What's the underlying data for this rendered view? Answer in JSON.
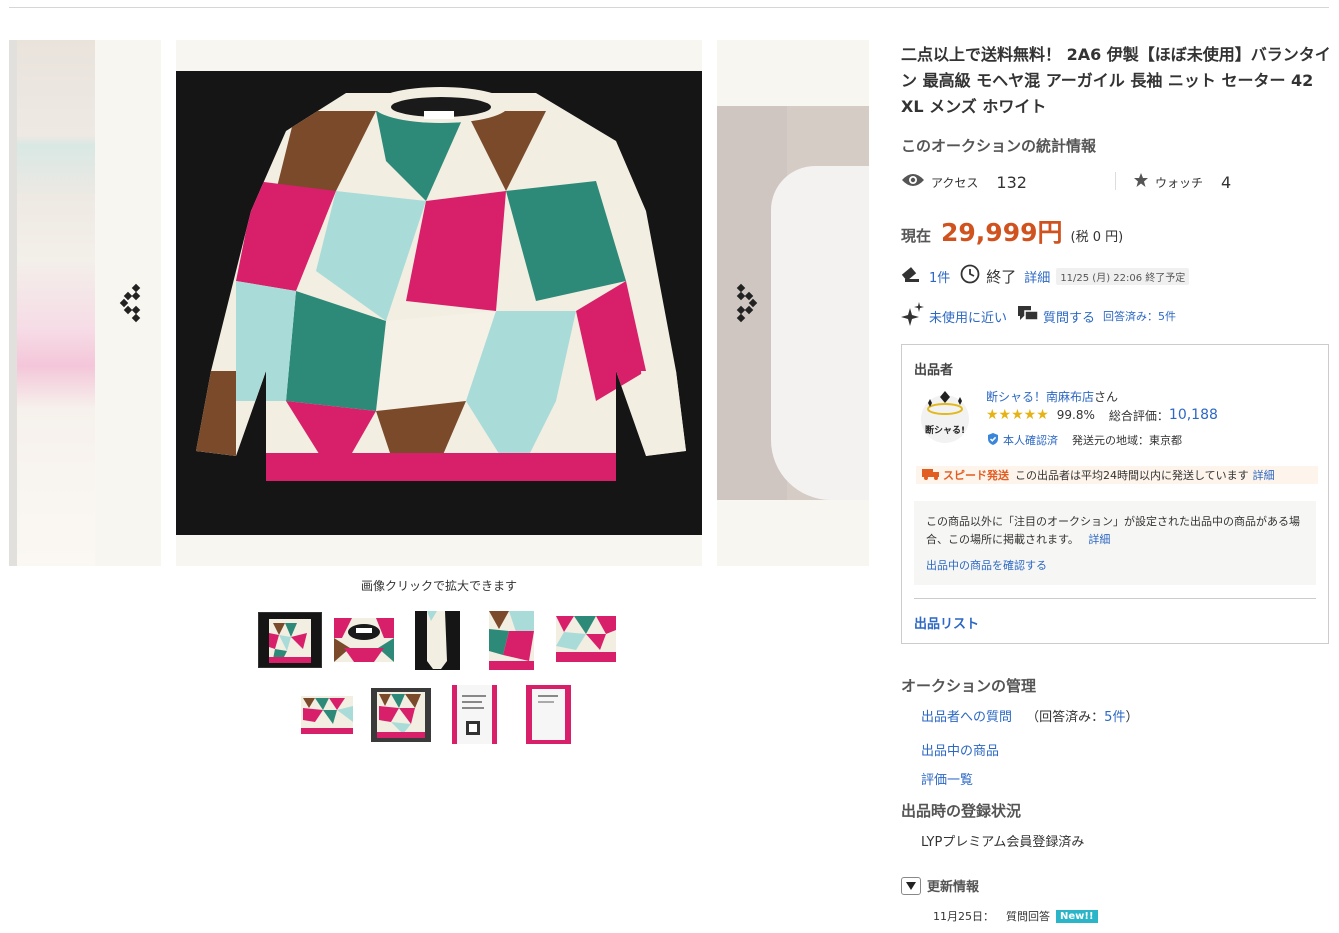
{
  "gallery": {
    "caption": "画像クリックで拡大できます",
    "prev_label": "前の画像",
    "next_label": "次の画像",
    "thumbnail_count": 10
  },
  "item": {
    "title": "二点以上で送料無料！ 2A6 伊製【ほぼ未使用】バランタイン 最高級 モヘヤ混 アーガイル 長袖 ニット セーター 42 XL メンズ ホワイト"
  },
  "stats": {
    "heading": "このオークションの統計情報",
    "access_label": "アクセス",
    "access_count": "132",
    "watch_label": "ウォッチ",
    "watch_count": "4"
  },
  "price": {
    "label": "現在",
    "value": "29,999円",
    "tax": "(税 0 円)"
  },
  "bids": {
    "count": "1件",
    "end_label": "終了",
    "detail_link": "詳細",
    "end_time": "11/25 (月) 22:06 終了予定"
  },
  "condition": {
    "label": "未使用に近い",
    "question_link": "質問する",
    "answered": "回答済み：5件"
  },
  "seller": {
    "heading": "出品者",
    "logo_text": "断シャる!",
    "name": "断シャる！南麻布店",
    "name_suffix": "さん",
    "rating_pct": "99.8%",
    "rating_label": "総合評価：",
    "rating_count": "10,188",
    "verified": "本人確認済",
    "region": "発送元の地域：東京都",
    "speed_badge": "スピード発送",
    "speed_text": "この出品者は平均24時間以内に発送しています",
    "speed_detail": "詳細",
    "note_text": "この商品以外に「注目のオークション」が設定された出品中の商品がある場合、この場所に掲載されます。",
    "note_detail": "詳細",
    "note_link": "出品中の商品を確認する",
    "list_link": "出品リスト"
  },
  "management": {
    "heading": "オークションの管理",
    "question_link": "出品者への質問",
    "answered_prefix": "（回答済み：",
    "answered_count": "5件",
    "answered_suffix": "）",
    "items_link": "出品中の商品",
    "ratings_link": "評価一覧"
  },
  "registration": {
    "heading": "出品時の登録状況",
    "value": "LYPプレミアム会員登録済み"
  },
  "updates": {
    "heading": "更新情報",
    "date": "11月25日：",
    "event": "質問回答",
    "badge": "New!!"
  },
  "colors": {
    "link": "#2c68c4",
    "price": "#d0531f",
    "magenta": "#d81f6a",
    "teal": "#2e8a78",
    "brown": "#7a4a2a",
    "lightblue": "#a9dcd8",
    "cream": "#f4efe2"
  }
}
